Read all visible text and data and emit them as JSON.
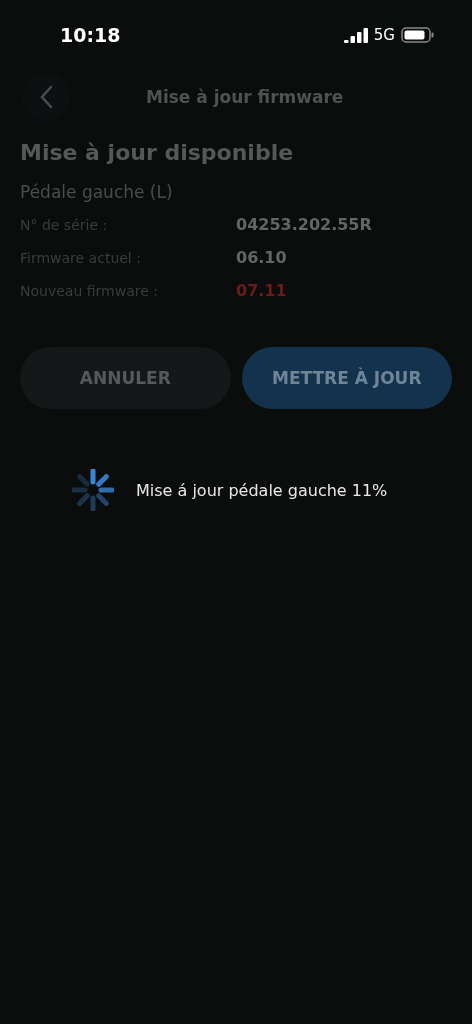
{
  "status_bar": {
    "time": "10:18",
    "network": "5G"
  },
  "header": {
    "title": "Mise à jour firmware"
  },
  "heading": "Mise à jour disponible",
  "device": "Pédale gauche (L)",
  "info_rows": [
    {
      "label": "N° de série :",
      "value": "04253.202.55R",
      "kind": "plain"
    },
    {
      "label": "Firmware actuel :",
      "value": "06.10",
      "kind": "plain"
    },
    {
      "label": "Nouveau firmware :",
      "value": "07.11",
      "kind": "new"
    }
  ],
  "buttons": [
    {
      "label": "ANNULER",
      "kind": "secondary"
    },
    {
      "label": "METTRE À JOUR",
      "kind": "primary"
    }
  ],
  "progress": {
    "text": "Mise á jour pédale gauche 11%"
  }
}
